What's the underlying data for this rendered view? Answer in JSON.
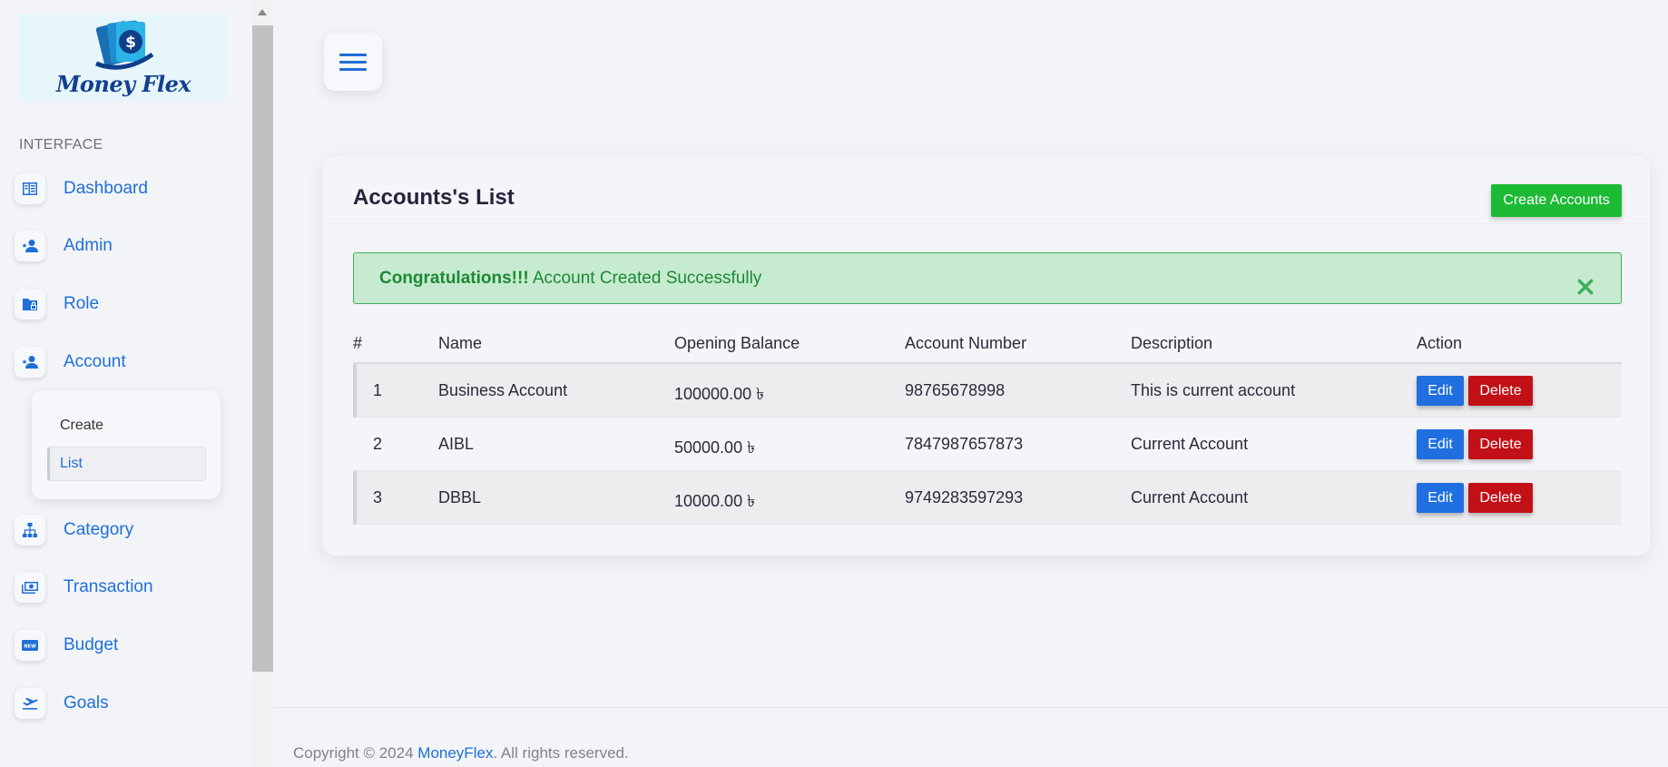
{
  "brand": {
    "name": "Money Flex"
  },
  "sidebar": {
    "section_label": "INTERFACE",
    "items": [
      {
        "label": "Dashboard",
        "icon": "dashboard-icon"
      },
      {
        "label": "Admin",
        "icon": "admin-user-icon"
      },
      {
        "label": "Role",
        "icon": "folder-lock-icon"
      },
      {
        "label": "Account",
        "icon": "account-user-icon"
      },
      {
        "label": "Category",
        "icon": "sitemap-icon"
      },
      {
        "label": "Transaction",
        "icon": "money-icon"
      },
      {
        "label": "Budget",
        "icon": "new-badge-icon"
      },
      {
        "label": "Goals",
        "icon": "plane-departure-icon"
      }
    ],
    "submenu": {
      "create": "Create",
      "list": "List"
    }
  },
  "card": {
    "title": "Accounts's List",
    "create_button": "Create Accounts"
  },
  "alert": {
    "strong": "Congratulations!!!",
    "message": " Account Created Successfully"
  },
  "table": {
    "headers": [
      "#",
      "Name",
      "Opening Balance",
      "Account Number",
      "Description",
      "Action"
    ],
    "rows": [
      {
        "num": "1",
        "name": "Business Account",
        "balance": "100000.00 ৳",
        "account_number": "98765678998",
        "description": "This is current account"
      },
      {
        "num": "2",
        "name": "AIBL",
        "balance": "50000.00 ৳",
        "account_number": "7847987657873",
        "description": "Current Account"
      },
      {
        "num": "3",
        "name": "DBBL",
        "balance": "10000.00 ৳",
        "account_number": "9749283597293",
        "description": "Current Account"
      }
    ],
    "edit_label": "Edit",
    "delete_label": "Delete"
  },
  "footer": {
    "prefix": "Copyright © 2024 ",
    "brand": "MoneyFlex",
    "suffix": ". All rights reserved."
  },
  "colors": {
    "accent": "#1f6fd6",
    "success": "#1cba35",
    "danger": "#c21017",
    "alert_bg": "#c7ebd0"
  }
}
